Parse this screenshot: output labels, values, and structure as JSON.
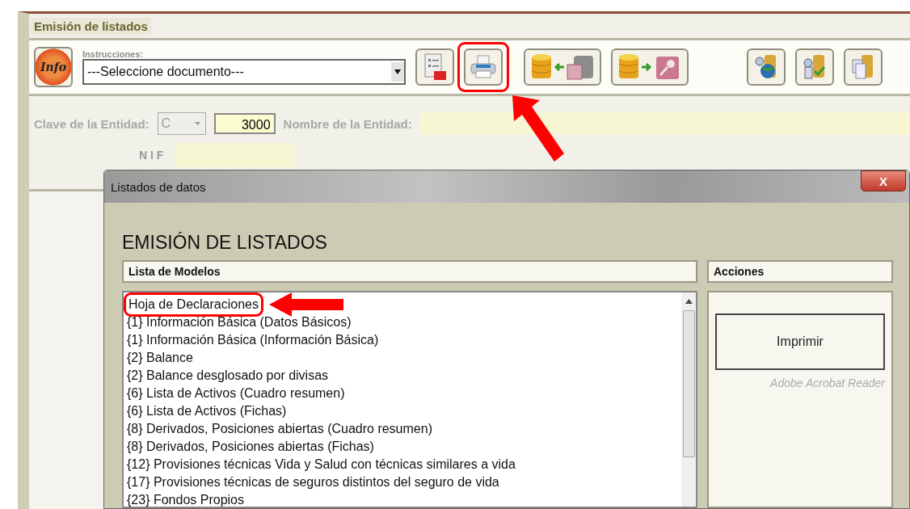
{
  "window": {
    "title": "Emisión de listados"
  },
  "toolbar": {
    "info_button": "Info",
    "instructions_label": "Instrucciones:",
    "document_select": {
      "value": "---Seleccione documento---"
    },
    "buttons": [
      {
        "kind": "pdf-report",
        "highlighted": false
      },
      {
        "kind": "print",
        "highlighted": true
      },
      {
        "kind": "import-db",
        "highlighted": false
      },
      {
        "kind": "export-db",
        "highlighted": false
      },
      {
        "kind": "search-globe",
        "highlighted": false
      },
      {
        "kind": "search-check",
        "highlighted": false
      },
      {
        "kind": "copy-db",
        "highlighted": false
      }
    ]
  },
  "entity": {
    "key_label": "Clave de la Entidad:",
    "key_type": {
      "value": "C",
      "disabled": true
    },
    "key_value": "3000",
    "name_label": "Nombre de la Entidad:",
    "nif_label": "N I F"
  },
  "dialog": {
    "title": "Listados de datos",
    "close": "X",
    "heading": "EMISIÓN DE LISTADOS",
    "models": {
      "header": "Lista de Modelos",
      "items": [
        {
          "label": "Hoja de Declaraciones",
          "highlighted": true
        },
        {
          "label": "{1} Información Básica (Datos Básicos)",
          "highlighted": false
        },
        {
          "label": "{1} Información Básica (Información Básica)",
          "highlighted": false
        },
        {
          "label": "{2} Balance",
          "highlighted": false
        },
        {
          "label": "{2} Balance desglosado por divisas",
          "highlighted": false
        },
        {
          "label": "{6} Lista de Activos (Cuadro resumen)",
          "highlighted": false
        },
        {
          "label": "{6} Lista de Activos (Fichas)",
          "highlighted": false
        },
        {
          "label": "{8} Derivados, Posiciones abiertas (Cuadro resumen)",
          "highlighted": false
        },
        {
          "label": "{8} Derivados, Posiciones abiertas (Fichas)",
          "highlighted": false
        },
        {
          "label": "{12} Provisiones técnicas Vida y Salud con técnicas similares a vida",
          "highlighted": false
        },
        {
          "label": "{17} Provisiones técnicas de seguros distintos del seguro de vida",
          "highlighted": false
        },
        {
          "label": "{23} Fondos Propios",
          "highlighted": false
        }
      ]
    },
    "actions": {
      "header": "Acciones",
      "print_button": "Imprimir",
      "print_note": "Adobe Acrobat Reader"
    }
  }
}
